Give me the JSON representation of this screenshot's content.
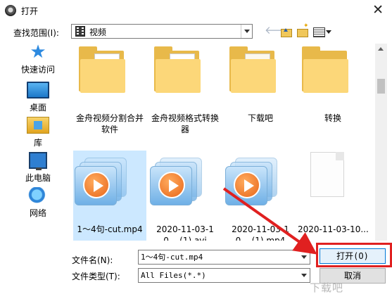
{
  "window": {
    "title": "打开",
    "close_glyph": "✕"
  },
  "toolbar": {
    "lookin_label": "查找范围(I):",
    "lookin_value": "视频",
    "icons": [
      "back-arrow-icon",
      "up-folder-icon",
      "new-folder-icon",
      "view-menu-icon"
    ]
  },
  "places": [
    {
      "label": "快速访问",
      "icon": "quick-access-icon"
    },
    {
      "label": "桌面",
      "icon": "desktop-icon"
    },
    {
      "label": "库",
      "icon": "libraries-icon"
    },
    {
      "label": "此电脑",
      "icon": "this-pc-icon"
    },
    {
      "label": "网络",
      "icon": "network-icon"
    }
  ],
  "files": [
    {
      "name": "金舟视频分割合并软件",
      "kind": "folder",
      "content": "orange-play"
    },
    {
      "name": "金舟视频格式转换器",
      "kind": "folder",
      "content": "blue-ring"
    },
    {
      "name": "下载吧",
      "kind": "folder",
      "content": "empty"
    },
    {
      "name": "转换",
      "kind": "folder",
      "content": "empty"
    },
    {
      "name": "1～4句-cut.mp4",
      "kind": "video",
      "selected": true
    },
    {
      "name": "2020-11-03-10... (1).avi",
      "kind": "video"
    },
    {
      "name": "2020-11-03-10... (1).mp4",
      "kind": "video"
    },
    {
      "name": "2020-11-03-10...",
      "kind": "blank"
    }
  ],
  "form": {
    "filename_label": "文件名(N):",
    "filename_value": "1～4句-cut.mp4",
    "filetype_label": "文件类型(T):",
    "filetype_value": "All Files(*.*)",
    "open_label": "打开(O)",
    "cancel_label": "取消"
  },
  "annotation": {
    "highlight_color": "#e02020"
  },
  "watermark": "下载吧"
}
